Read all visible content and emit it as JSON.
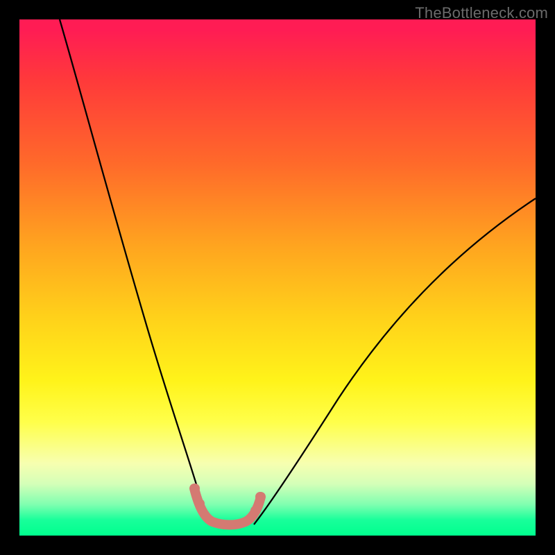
{
  "watermark": "TheBottleneck.com",
  "chart_data": {
    "type": "line",
    "title": "",
    "xlabel": "",
    "ylabel": "",
    "xlim": [
      0,
      1
    ],
    "ylim": [
      0,
      1
    ],
    "grid": false,
    "legend": false,
    "gradient_stops": [
      {
        "pos": 0.0,
        "color": "#ff1c54"
      },
      {
        "pos": 0.12,
        "color": "#ff3a3a"
      },
      {
        "pos": 0.28,
        "color": "#ff6a2a"
      },
      {
        "pos": 0.44,
        "color": "#ffa51f"
      },
      {
        "pos": 0.58,
        "color": "#ffd21a"
      },
      {
        "pos": 0.7,
        "color": "#fff31a"
      },
      {
        "pos": 0.86,
        "color": "#f7ffb0"
      },
      {
        "pos": 0.94,
        "color": "#7fffb0"
      },
      {
        "pos": 1.0,
        "color": "#00ff8e"
      }
    ],
    "series": [
      {
        "name": "left-curve",
        "stroke": "#000000",
        "x": [
          0.08,
          0.12,
          0.16,
          0.2,
          0.24,
          0.28,
          0.31,
          0.34,
          0.365
        ],
        "y": [
          1.0,
          0.86,
          0.72,
          0.58,
          0.44,
          0.3,
          0.18,
          0.08,
          0.02
        ]
      },
      {
        "name": "right-curve",
        "stroke": "#000000",
        "x": [
          0.45,
          0.5,
          0.56,
          0.63,
          0.72,
          0.82,
          0.92,
          1.0
        ],
        "y": [
          0.02,
          0.07,
          0.15,
          0.25,
          0.38,
          0.5,
          0.6,
          0.66
        ]
      },
      {
        "name": "trough-marker",
        "stroke": "#d97b72",
        "x": [
          0.34,
          0.355,
          0.37,
          0.385,
          0.4,
          0.42,
          0.44,
          0.455,
          0.465
        ],
        "y": [
          0.085,
          0.055,
          0.035,
          0.025,
          0.023,
          0.025,
          0.032,
          0.05,
          0.075
        ]
      }
    ],
    "annotations": []
  }
}
